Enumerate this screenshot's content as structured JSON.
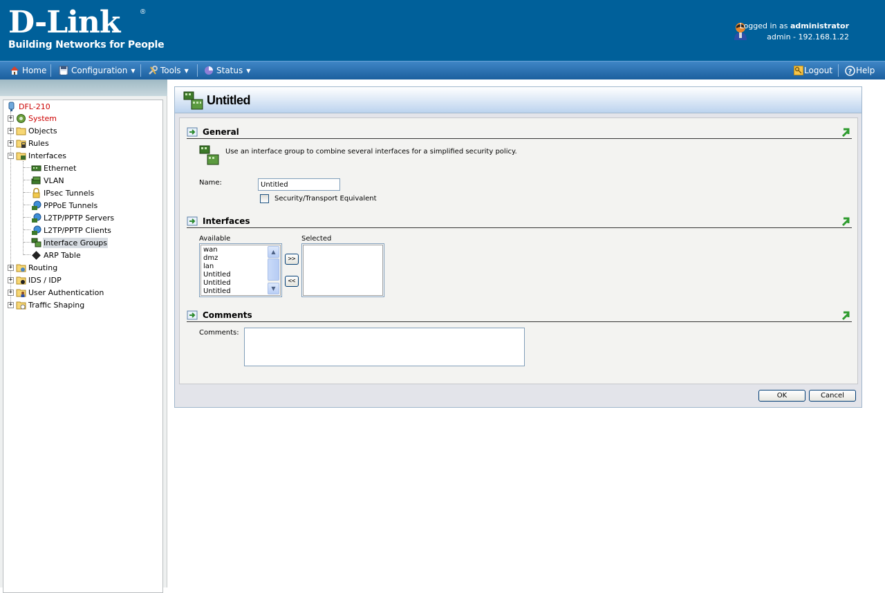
{
  "header": {
    "logo_text": "D-Link",
    "logo_registered": "®",
    "tagline": "Building Networks for People",
    "login_prefix": "Logged in as",
    "login_user": "administrator",
    "session": "admin - 192.168.1.22"
  },
  "menu": {
    "home": "Home",
    "configuration": "Configuration",
    "tools": "Tools",
    "status": "Status",
    "logout": "Logout",
    "help": "Help"
  },
  "tree": {
    "root": "DFL-210",
    "system": "System",
    "objects": "Objects",
    "rules": "Rules",
    "interfaces": "Interfaces",
    "ethernet": "Ethernet",
    "vlan": "VLAN",
    "ipsec": "IPsec Tunnels",
    "pppoe": "PPPoE Tunnels",
    "l2tp_servers": "L2TP/PPTP Servers",
    "l2tp_clients": "L2TP/PPTP Clients",
    "interface_groups": "Interface Groups",
    "arp": "ARP Table",
    "routing": "Routing",
    "ids": "IDS / IDP",
    "user_auth": "User Authentication",
    "traffic": "Traffic Shaping"
  },
  "page": {
    "title": "Untitled",
    "general": {
      "heading": "General",
      "description": "Use an interface group to combine several interfaces for a simplified security policy.",
      "name_label": "Name:",
      "name_value": "Untitled",
      "equiv_label": "Security/Transport Equivalent",
      "equiv_checked": false
    },
    "interfaces": {
      "heading": "Interfaces",
      "available_label": "Available",
      "selected_label": "Selected",
      "available": [
        "wan",
        "dmz",
        "lan",
        "Untitled",
        "Untitled",
        "Untitled"
      ],
      "selected": [],
      "add_label": ">>",
      "remove_label": "<<"
    },
    "comments": {
      "heading": "Comments",
      "label": "Comments:",
      "value": ""
    },
    "ok_label": "OK",
    "cancel_label": "Cancel"
  },
  "colors": {
    "header_bg": "#00609a",
    "menubar": "#2a6fb0",
    "alert_red": "#cc0000"
  }
}
